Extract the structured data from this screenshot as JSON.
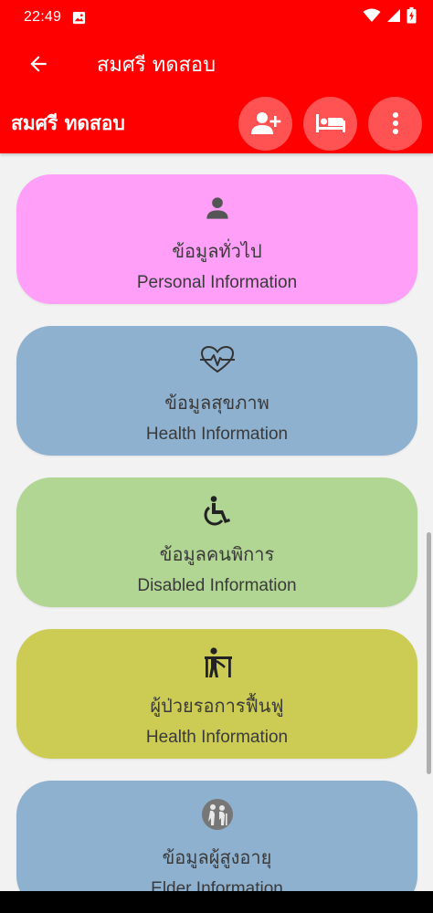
{
  "status_bar": {
    "time": "22:49"
  },
  "app_bar": {
    "title": "สมศรี ทดสอบ"
  },
  "sub_header": {
    "title": "สมศรี ทดสอบ"
  },
  "cards": [
    {
      "th": "ข้อมูลทั่วไป",
      "en": "Personal Information",
      "color": "#ff9ff8",
      "icon": "person-icon"
    },
    {
      "th": "ข้อมูลสุขภาพ",
      "en": "Health Information",
      "color": "#8fb1d0",
      "icon": "heart-pulse-icon"
    },
    {
      "th": "ข้อมูลคนพิการ",
      "en": "Disabled Information",
      "color": "#b1d592",
      "icon": "wheelchair-icon"
    },
    {
      "th": "ผู้ป่วยรอการฟื้นฟู",
      "en": "Health Information",
      "color": "#cccc55",
      "icon": "rehabilitation-icon"
    },
    {
      "th": "ข้อมูลผู้สูงอายุ",
      "en": "Elder Information",
      "color": "#8fb1d0",
      "icon": "elderly-icon"
    }
  ]
}
